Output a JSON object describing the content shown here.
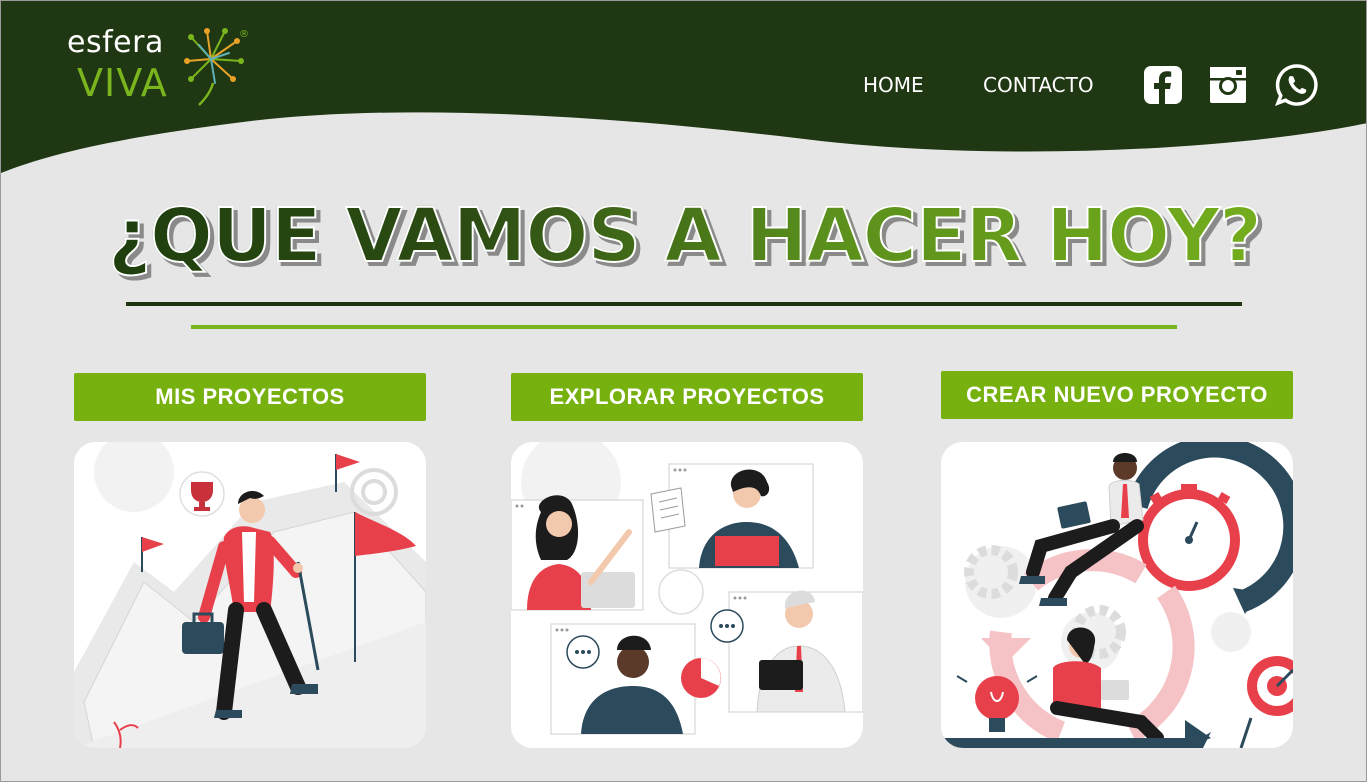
{
  "brand": {
    "name_top": "esfera",
    "name_bottom": "VIVA",
    "registered": "®"
  },
  "nav": {
    "home": "HOME",
    "contact": "CONTACTO"
  },
  "social": [
    {
      "icon": "facebook-icon"
    },
    {
      "icon": "instagram-icon"
    },
    {
      "icon": "whatsapp-icon"
    }
  ],
  "hero": {
    "title": "¿QUE VAMOS A HACER HOY?"
  },
  "actions": {
    "my_projects": "MIS PROYECTOS",
    "explore_projects": "EXPLORAR  PROYECTOS",
    "create_project": "CREAR NUEVO PROYECTO"
  },
  "colors": {
    "header_dark": "#1f3712",
    "accent_green": "#76b10f",
    "light_green": "#7ab51d",
    "illustration_red": "#e8404a",
    "illustration_navy": "#2b4a5c",
    "page_bg": "#e6e6e6"
  }
}
